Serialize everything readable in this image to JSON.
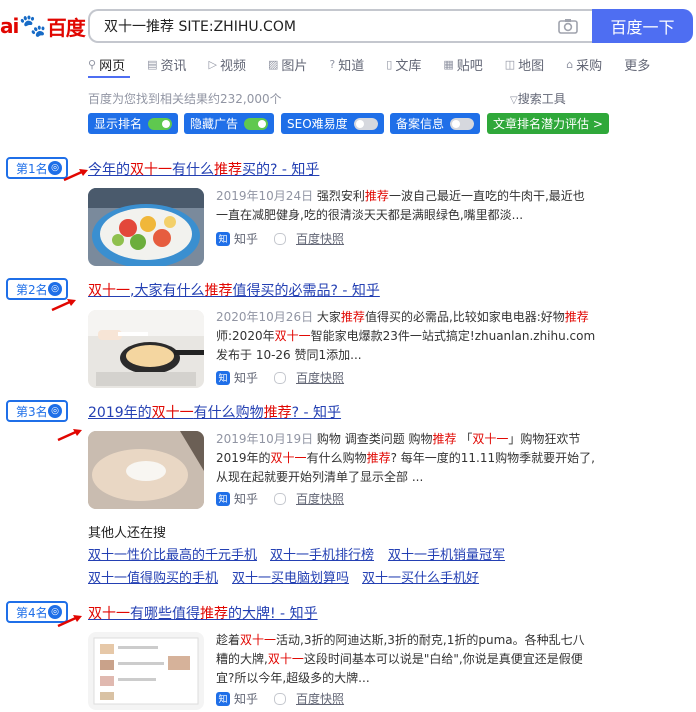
{
  "logo": {
    "left": "ai",
    "paw": "du",
    "right": "百度"
  },
  "search": {
    "query": "双十一推荐 SITE:ZHIHU.COM",
    "button": "百度一下"
  },
  "tabs": [
    {
      "icon": "search-icon",
      "label": "网页"
    },
    {
      "icon": "news-icon",
      "label": "资讯"
    },
    {
      "icon": "video-icon",
      "label": "视频"
    },
    {
      "icon": "image-icon",
      "label": "图片"
    },
    {
      "icon": "question-icon",
      "label": "知道"
    },
    {
      "icon": "document-icon",
      "label": "文库"
    },
    {
      "icon": "tieba-icon",
      "label": "贴吧"
    },
    {
      "icon": "map-icon",
      "label": "地图"
    },
    {
      "icon": "purchase-icon",
      "label": "采购"
    },
    {
      "icon": "",
      "label": "更多"
    }
  ],
  "result_count": "百度为您找到相关结果约232,000个",
  "search_tools": "搜索工具",
  "toolbar": [
    {
      "label": "显示排名",
      "toggle": "on"
    },
    {
      "label": "隐藏广告",
      "toggle": "on"
    },
    {
      "label": "SEO难易度",
      "toggle": "off"
    },
    {
      "label": "备案信息",
      "toggle": "off"
    },
    {
      "label": "文章排名潜力评估 >",
      "toggle": ""
    }
  ],
  "results": [
    {
      "rank": "第1名",
      "title_parts": [
        "今年的",
        "双十一",
        "有什么",
        "推荐",
        "买的? - 知乎"
      ],
      "snippet_date": "2019年10月24日",
      "snippet_parts": [
        " 强烈安利",
        "推荐",
        "一波自己最近一直吃的牛肉干,最近也一直在减肥健身,吃的很清淡天天都是满眼绿色,嘴里都淡..."
      ],
      "source": "知乎",
      "snapshot": "百度快照"
    },
    {
      "rank": "第2名",
      "title_parts": [
        "双十一",
        ",大家有什么",
        "推荐",
        "值得买的必需品? - 知乎"
      ],
      "snippet_date": "2020年10月26日",
      "snippet_parts": [
        " 大家",
        "推荐",
        "值得买的必需品,比较如家电电器:好物",
        "推荐",
        "师:2020年",
        "双十一",
        "智能家电爆款23件一站式搞定!zhuanlan.zhihu.com 发布于 10-26 赞同1添加..."
      ],
      "source": "知乎",
      "snapshot": "百度快照"
    },
    {
      "rank": "第3名",
      "title_parts": [
        "2019年的",
        "双十一",
        "有什么购物",
        "推荐",
        "? - 知乎"
      ],
      "snippet_date": "2019年10月19日",
      "snippet_parts": [
        " 购物 调查类问题 购物",
        "推荐",
        " 「",
        "双十一",
        "」购物狂欢节 2019年的",
        "双十一",
        "有什么购物",
        "推荐",
        "? 每年一度的11.11购物季就要开始了,从现在起就要开始列清单了显示全部 ..."
      ],
      "source": "知乎",
      "snapshot": "百度快照"
    },
    {
      "rank": "第4名",
      "title_parts": [
        "双十一",
        "有哪些值得",
        "推荐",
        "的大牌! - 知乎"
      ],
      "snippet_date": "",
      "snippet_parts": [
        "趁着",
        "双十一",
        "活动,3折的阿迪达斯,3折的耐克,1折的puma。各种乱七八糟的大牌,",
        "双十一",
        "这段时间基本可以说是\"白给\",你说是真便宜还是假便宜?所以今年,超级多的大牌..."
      ],
      "source": "知乎",
      "snapshot": "百度快照"
    }
  ],
  "others": {
    "title": "其他人还在搜",
    "links": [
      "双十一性价比最高的千元手机",
      "双十一手机排行榜",
      "双十一手机销量冠军",
      "双十一值得购买的手机",
      "双十一买电脑划算吗",
      "双十一买什么手机好"
    ]
  },
  "colors": {
    "accent": "#4e6ef2",
    "link": "#2440b3",
    "highlight": "#e10601",
    "badge": "#1f6fe8"
  }
}
